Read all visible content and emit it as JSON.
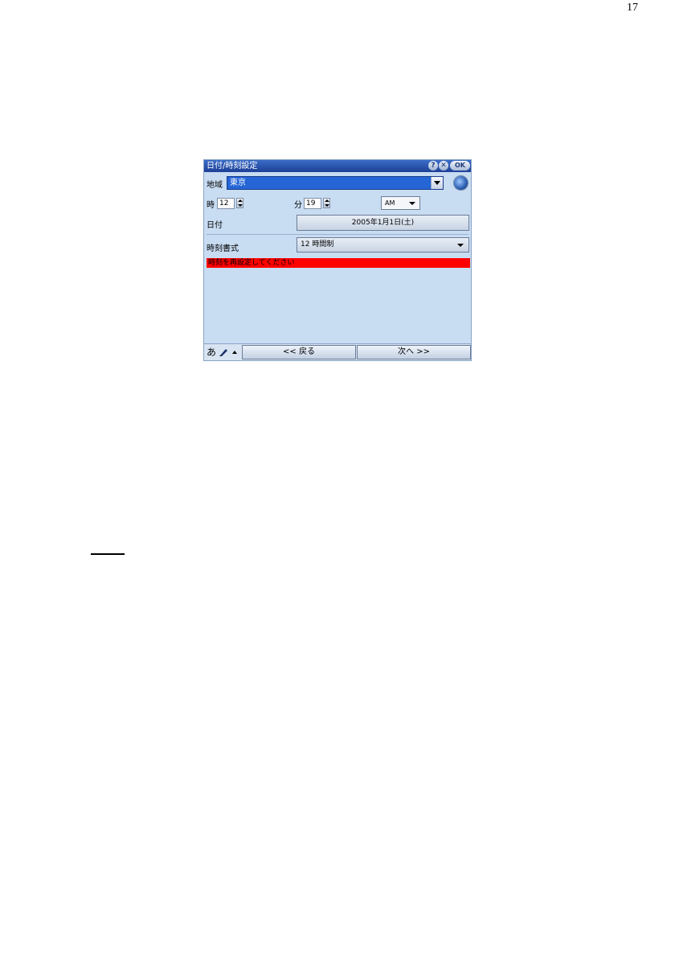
{
  "page": {
    "number": "17"
  },
  "window": {
    "title": "日付/時刻設定",
    "help_label": "?",
    "close_label": "✕",
    "ok_label": "OK"
  },
  "region": {
    "label": "地域",
    "value": "東京"
  },
  "time": {
    "hour_label": "時",
    "hour_value": "12",
    "minute_label": "分",
    "minute_value": "19",
    "ampm_value": "AM"
  },
  "date": {
    "label": "日付",
    "value": "2005年1月1日(土)"
  },
  "format": {
    "label": "時刻書式",
    "value": "12 時間制"
  },
  "warning": {
    "text": "時刻を再設定してください"
  },
  "bottom": {
    "ime_label": "あ",
    "back_label": "<< 戻る",
    "next_label": "次へ >>"
  },
  "colors": {
    "window_bg": "#c8dcf2",
    "title_bg": "#1e3f96",
    "selection": "#2565d6",
    "warning_bg": "#ff0000"
  },
  "icons": [
    "help-icon",
    "close-icon",
    "globe-icon",
    "pen-icon",
    "up-arrow-icon",
    "dropdown-arrow-icon",
    "spinner-icon"
  ]
}
